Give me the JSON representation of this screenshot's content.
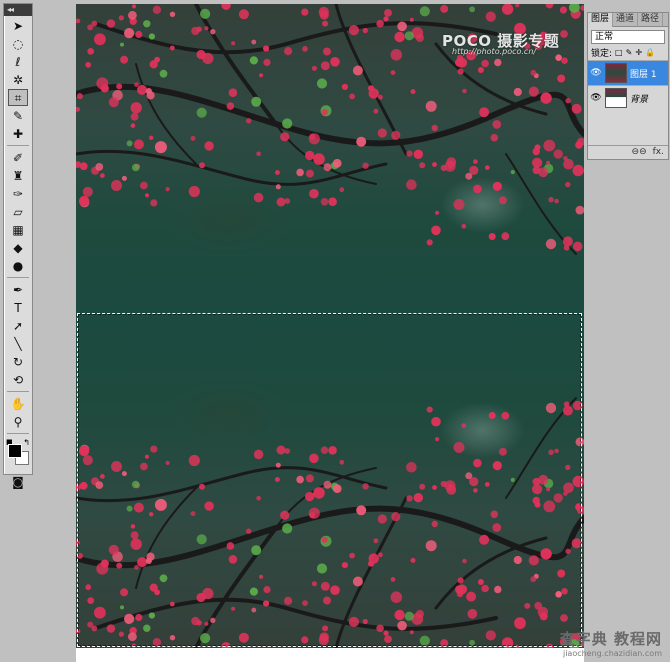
{
  "toolbox": {
    "grip": "◂◂",
    "tools": [
      {
        "name": "move-tool",
        "glyph": "➤"
      },
      {
        "name": "marquee-tool",
        "glyph": "◌"
      },
      {
        "name": "lasso-tool",
        "glyph": "ℓ"
      },
      {
        "name": "magic-wand-tool",
        "glyph": "✲"
      },
      {
        "name": "crop-tool",
        "glyph": "⌗"
      },
      {
        "name": "eyedropper-tool",
        "glyph": "✎"
      },
      {
        "name": "healing-brush-tool",
        "glyph": "✚"
      },
      {
        "name": "brush-tool",
        "glyph": "✐"
      },
      {
        "name": "clone-stamp-tool",
        "glyph": "♜"
      },
      {
        "name": "history-brush-tool",
        "glyph": "✑"
      },
      {
        "name": "eraser-tool",
        "glyph": "▱"
      },
      {
        "name": "gradient-tool",
        "glyph": "▦"
      },
      {
        "name": "blur-tool",
        "glyph": "◆"
      },
      {
        "name": "dodge-tool",
        "glyph": "●"
      },
      {
        "name": "pen-tool",
        "glyph": "✒"
      },
      {
        "name": "type-tool",
        "glyph": "T"
      },
      {
        "name": "path-selection-tool",
        "glyph": "➚"
      },
      {
        "name": "line-tool",
        "glyph": "╲"
      },
      {
        "name": "3d-rotate-tool",
        "glyph": "↻"
      },
      {
        "name": "3d-orbit-tool",
        "glyph": "⟲"
      },
      {
        "name": "hand-tool",
        "glyph": "✋"
      },
      {
        "name": "zoom-tool",
        "glyph": "⚲"
      }
    ],
    "active_tool": "crop-tool",
    "swap_glyph": "↰",
    "default_glyph": "■",
    "quickmask_glyph": "◙",
    "foreground_color": "#000000",
    "background_color": "#ffffff"
  },
  "canvas": {
    "watermark_brand": "POCO 摄影专题",
    "watermark_url": "http://photo.poco.cn/"
  },
  "layers_panel": {
    "tabs": [
      "图层",
      "通道",
      "路径"
    ],
    "active_tab": "图层",
    "blend_mode": "正常",
    "lock_label": "锁定:",
    "lock_icons": [
      "□",
      "✎",
      "✛",
      "🔒"
    ],
    "layers": [
      {
        "name": "图层 1",
        "visible": true,
        "selected": true
      },
      {
        "name": "背景",
        "visible": true,
        "selected": false
      }
    ],
    "footer_icons": [
      "⊖⊖",
      "fx."
    ]
  },
  "site_mark": {
    "title": "查字典 教程网",
    "url": "jiaocheng.chazidian.com"
  }
}
